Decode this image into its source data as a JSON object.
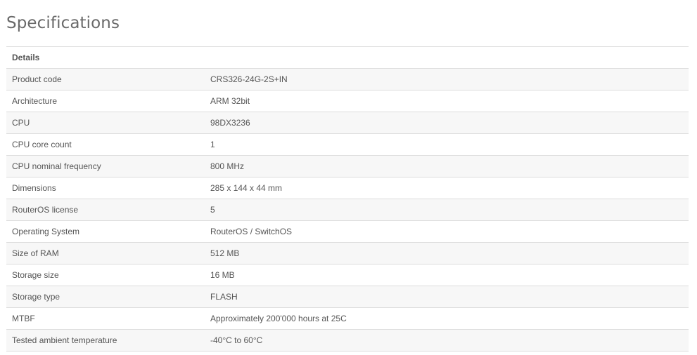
{
  "page_title": "Specifications",
  "table": {
    "header": "Details",
    "rows": [
      {
        "name": "Product code",
        "value": "CRS326-24G-2S+IN"
      },
      {
        "name": "Architecture",
        "value": "ARM 32bit"
      },
      {
        "name": "CPU",
        "value": "98DX3236"
      },
      {
        "name": "CPU core count",
        "value": "1"
      },
      {
        "name": "CPU nominal frequency",
        "value": "800 MHz"
      },
      {
        "name": "Dimensions",
        "value": "285 x 144 x 44 mm"
      },
      {
        "name": "RouterOS license",
        "value": "5"
      },
      {
        "name": "Operating System",
        "value": "RouterOS / SwitchOS"
      },
      {
        "name": "Size of RAM",
        "value": "512 MB"
      },
      {
        "name": "Storage size",
        "value": "16 MB"
      },
      {
        "name": "Storage type",
        "value": "FLASH"
      },
      {
        "name": "MTBF",
        "value": "Approximately 200'000 hours at 25C"
      },
      {
        "name": "Tested ambient temperature",
        "value": "-40°C to 60°C"
      }
    ]
  }
}
